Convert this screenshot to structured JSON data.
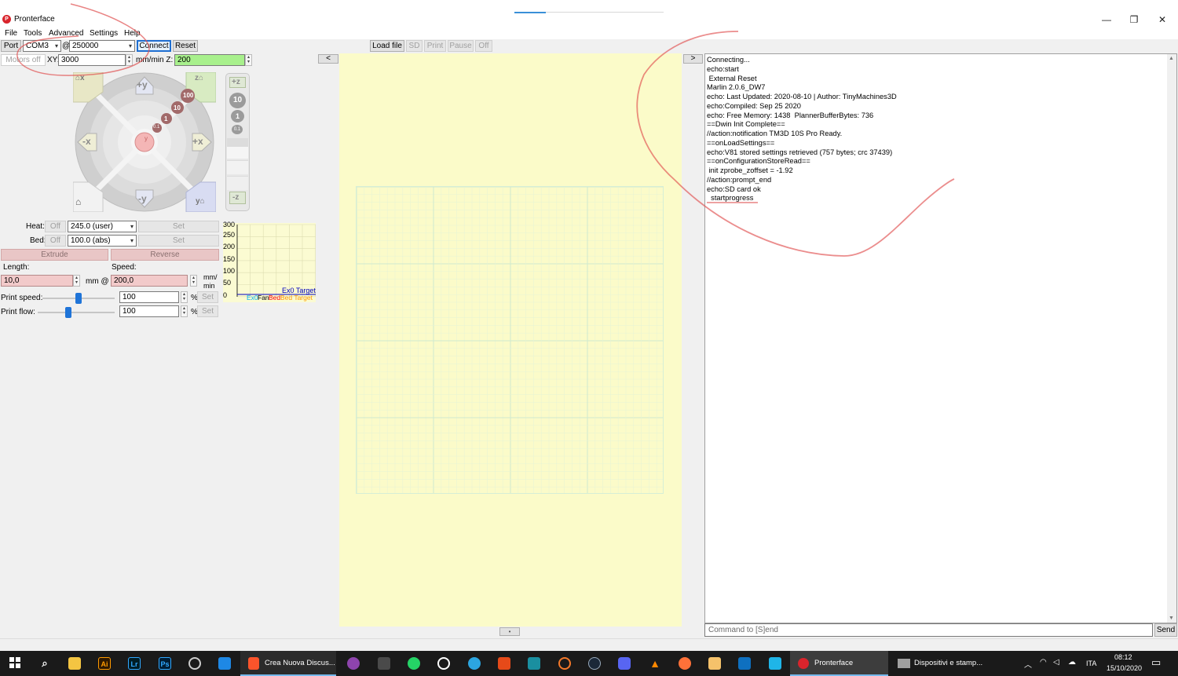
{
  "window": {
    "title": "Pronterface",
    "app_icon_letter": "P",
    "minimize_glyph": "—",
    "restore_glyph": "❐",
    "close_glyph": "✕"
  },
  "menu": [
    "File",
    "Tools",
    "Advanced",
    "Settings",
    "Help"
  ],
  "connection": {
    "port_label": "Port",
    "port_value": "COM3",
    "at_symbol": "@",
    "baud_value": "250000",
    "connect_label": "Connect",
    "reset_label": "Reset"
  },
  "motion": {
    "motors_off_label": "Motors off",
    "xy_label": "XY:",
    "xy_value": "3000",
    "z_label": "mm/min Z:",
    "z_value": "200"
  },
  "jog": {
    "plus_y": "+y",
    "minus_y": "-y",
    "plus_x": "+x",
    "minus_x": "-x",
    "plus_z": "+z",
    "minus_z": "-z",
    "home_x": "x",
    "home_z": "z",
    "home_y": "y",
    "steps": [
      "100",
      "10",
      "1",
      "0.1"
    ],
    "zsteps": [
      "10",
      "1",
      "0.1"
    ],
    "center": "y"
  },
  "temps": {
    "heat_label": "Heat:",
    "heat_off": "Off",
    "heat_value": "245.0 (user)",
    "heat_set": "Set",
    "bed_label": "Bed:",
    "bed_off": "Off",
    "bed_value": "100.0 (abs)",
    "bed_set": "Set",
    "extrude_label": "Extrude",
    "reverse_label": "Reverse",
    "length_label": "Length:",
    "length_value": "10,0",
    "mm_at": "mm @",
    "speed_label": "Speed:",
    "speed_value": "200,0",
    "speed_unit_top": "mm/",
    "speed_unit_bottom": "min",
    "print_speed_label": "Print speed:",
    "print_speed_value": "100",
    "print_flow_label": "Print flow:",
    "print_flow_value": "100",
    "percent": "%",
    "set_label": "Set",
    "print_speed_level": 0.5,
    "print_flow_level": 0.5
  },
  "graph": {
    "ticks": [
      "300",
      "250",
      "200",
      "150",
      "100",
      "50",
      "0"
    ],
    "ex0_target": "Ex0 Target",
    "legend_ex0": "Ex0",
    "legend_fan": "Fan",
    "legend_bed": "Bed",
    "legend_bed_target": "Bed Target",
    "colors": {
      "ex0": "#00b0f0",
      "fan": "#000000",
      "bed": "#ff0000",
      "bed_target": "#ff9900",
      "ex0_target": "#0000c0"
    }
  },
  "toolbar": {
    "collapse_left": "<",
    "load_file": "Load file",
    "sd": "SD",
    "print": "Print",
    "pause": "Pause",
    "off": "Off",
    "collapse_right": ">",
    "bottom_toggle": "•"
  },
  "console": {
    "lines": [
      "Connecting...",
      "echo:start",
      " External Reset",
      "Marlin 2.0.6_DW7",
      "echo: Last Updated: 2020-08-10 | Author: TinyMachines3D",
      "echo:Compiled: Sep 25 2020",
      "echo: Free Memory: 1438  PlannerBufferBytes: 736",
      "==Dwin Init Complete==",
      "//action:notification TM3D 10S Pro Ready.",
      "==onLoadSettings==",
      "echo:V81 stored settings retrieved (757 bytes; crc 37439)",
      "==onConfigurationStoreRead==",
      " init zprobe_zoffset = -1.92",
      "//action:prompt_end",
      "echo:SD card ok",
      "  startprogress"
    ],
    "command_placeholder": "Command to [S]end",
    "send_label": "Send"
  },
  "taskbar": {
    "apps": [
      {
        "label": "Crea Nuova Discus...",
        "active": false
      },
      {
        "label": "Pronterface",
        "active": true
      },
      {
        "label": "Dispositivi e stamp...",
        "active": false
      }
    ],
    "language": "ITA",
    "time": "08:12",
    "date": "15/10/2020",
    "icons": [
      "windows-start",
      "search",
      "file-explorer",
      "illustrator",
      "lightroom",
      "photoshop",
      "chrome-like",
      "visual-studio",
      "brave",
      "podcast",
      "calculator",
      "whatsapp",
      "recorder",
      "telegram",
      "git",
      "cura",
      "blender",
      "steam",
      "discord",
      "vlc",
      "firefox",
      "notepad",
      "onenote",
      "ccleaner"
    ],
    "icon_glyphs": {
      "illustrator": "Ai",
      "lightroom": "Lr",
      "photoshop": "Ps"
    }
  }
}
